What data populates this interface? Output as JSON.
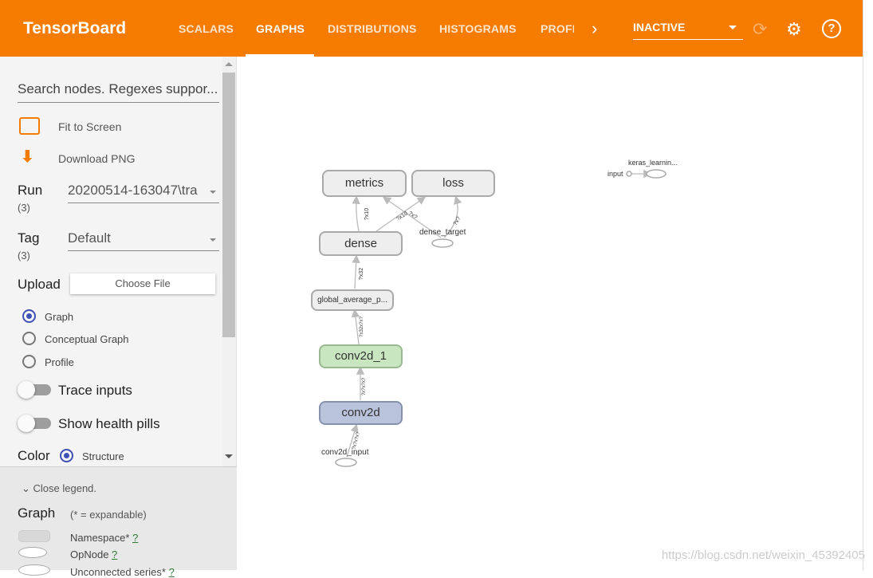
{
  "header": {
    "title": "TensorBoard",
    "tabs": [
      "SCALARS",
      "GRAPHS",
      "DISTRIBUTIONS",
      "HISTOGRAMS",
      "PROFI"
    ],
    "active_tab": "GRAPHS",
    "run_status": "INACTIVE",
    "icons": [
      "chevron-right-icon",
      "refresh-icon",
      "gear-icon",
      "help-icon"
    ]
  },
  "sidebar": {
    "search_placeholder": "Search nodes. Regexes suppor...",
    "fit_label": "Fit to Screen",
    "download_label": "Download PNG",
    "run_label": "Run",
    "run_count": "(3)",
    "run_value": "20200514-163047\\tra",
    "tag_label": "Tag",
    "tag_count": "(3)",
    "tag_value": "Default",
    "upload_label": "Upload",
    "choose_file": "Choose File",
    "graph_types": [
      "Graph",
      "Conceptual Graph",
      "Profile"
    ],
    "selected_graph_type": "Graph",
    "trace_inputs": "Trace inputs",
    "health_pills": "Show health pills",
    "color_label": "Color",
    "color_option": "Structure"
  },
  "legend": {
    "close": "Close legend.",
    "title": "Graph",
    "note": "(* = expandable)",
    "items": [
      "Namespace*",
      "OpNode",
      "Unconnected series*"
    ],
    "help": "?"
  },
  "graph": {
    "nodes": {
      "metrics": "metrics",
      "loss": "loss",
      "dense": "dense",
      "dense_target": "dense_target",
      "gap": "global_average_p...",
      "conv2d_1": "conv2d_1",
      "conv2d": "conv2d",
      "conv2d_input": "conv2d_input",
      "keras": "keras_learnin...",
      "input": "input"
    },
    "edge_labels": [
      "?x10",
      "?x10",
      "?x?",
      "?x?",
      "?x32",
      "?x32x?x?",
      "?x?x?x?",
      "?x?x?x?"
    ],
    "colors": {
      "conv2d_1": "#c8e6c0",
      "conv2d": "#b9c3dc",
      "default": "#eeeeee"
    }
  },
  "watermark": "https://blog.csdn.net/weixin_45392405"
}
